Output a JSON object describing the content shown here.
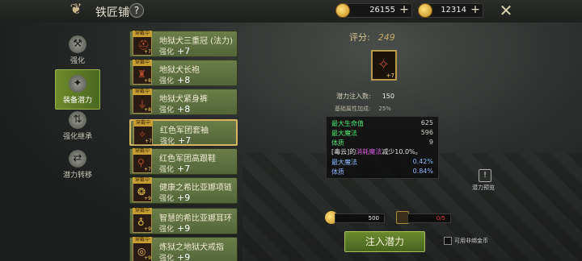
{
  "header": {
    "title": "铁匠铺",
    "help": "?",
    "gold": "26155",
    "gems": "12314"
  },
  "nav": [
    {
      "label": "强化",
      "icon": "anvil-icon"
    },
    {
      "label": "装备潜力",
      "icon": "gem-icon",
      "active": true
    },
    {
      "label": "强化继承",
      "icon": "inherit-icon"
    },
    {
      "label": "潜力转移",
      "icon": "transfer-icon"
    }
  ],
  "equip_list": [
    {
      "tag": "穿戴中",
      "name": "地狱犬三重冠 (法力)",
      "enh_label": "强化",
      "enh": "+7",
      "lv": "+7"
    },
    {
      "tag": "穿戴中",
      "name": "地狱犬长袍",
      "enh_label": "强化",
      "enh": "+8",
      "lv": "+8"
    },
    {
      "tag": "穿戴中",
      "name": "地狱犬紧身裤",
      "enh_label": "强化",
      "enh": "+8",
      "lv": "+8"
    },
    {
      "tag": "穿戴中",
      "name": "红色军团套袖",
      "enh_label": "强化",
      "enh": "+7",
      "lv": "+7"
    },
    {
      "tag": "穿戴中",
      "name": "红色军团高跟鞋",
      "enh_label": "强化",
      "enh": "+7",
      "lv": "+7"
    },
    {
      "tag": "穿戴中",
      "name": "健康之希比亚娜项链",
      "enh_label": "强化",
      "enh": "+9",
      "lv": "+9"
    },
    {
      "tag": "穿戴中",
      "name": "智慧的希比亚娜耳环",
      "enh_label": "强化",
      "enh": "+9",
      "lv": "+9"
    },
    {
      "tag": "穿戴中",
      "name": "炼狱之地狱犬戒指",
      "enh_label": "强化",
      "enh": "+9",
      "lv": "+9"
    }
  ],
  "detail": {
    "score_label": "评分:",
    "score": "249",
    "item_lv": "+7",
    "injected_label": "潜力注入数:",
    "injected": "150",
    "bonus_label": "基础属性加成:",
    "bonus": "25%",
    "attrs": [
      {
        "k": "最大生命值",
        "v": "625"
      },
      {
        "k": "最大魔法",
        "v": "596"
      },
      {
        "k": "体质",
        "v": "9"
      }
    ],
    "effect_pre": "[毒云]的",
    "effect_mid": "消耗魔法",
    "effect_post": "减少10.0%。",
    "bonus_attrs": [
      {
        "k": "最大魔法",
        "v": "0.42%"
      },
      {
        "k": "体质",
        "v": "0.84%"
      }
    ]
  },
  "note_label": "潜力预览",
  "cost_gold": "500",
  "cost_item": "0/5",
  "submit": "注入潜力",
  "checkbox_label": "可用非绑金币",
  "colors": {
    "accent_green": "#5e7e28",
    "gold": "#d6b65e",
    "attr_green": "#4be56e",
    "attr_blue": "#8bb7ff"
  }
}
